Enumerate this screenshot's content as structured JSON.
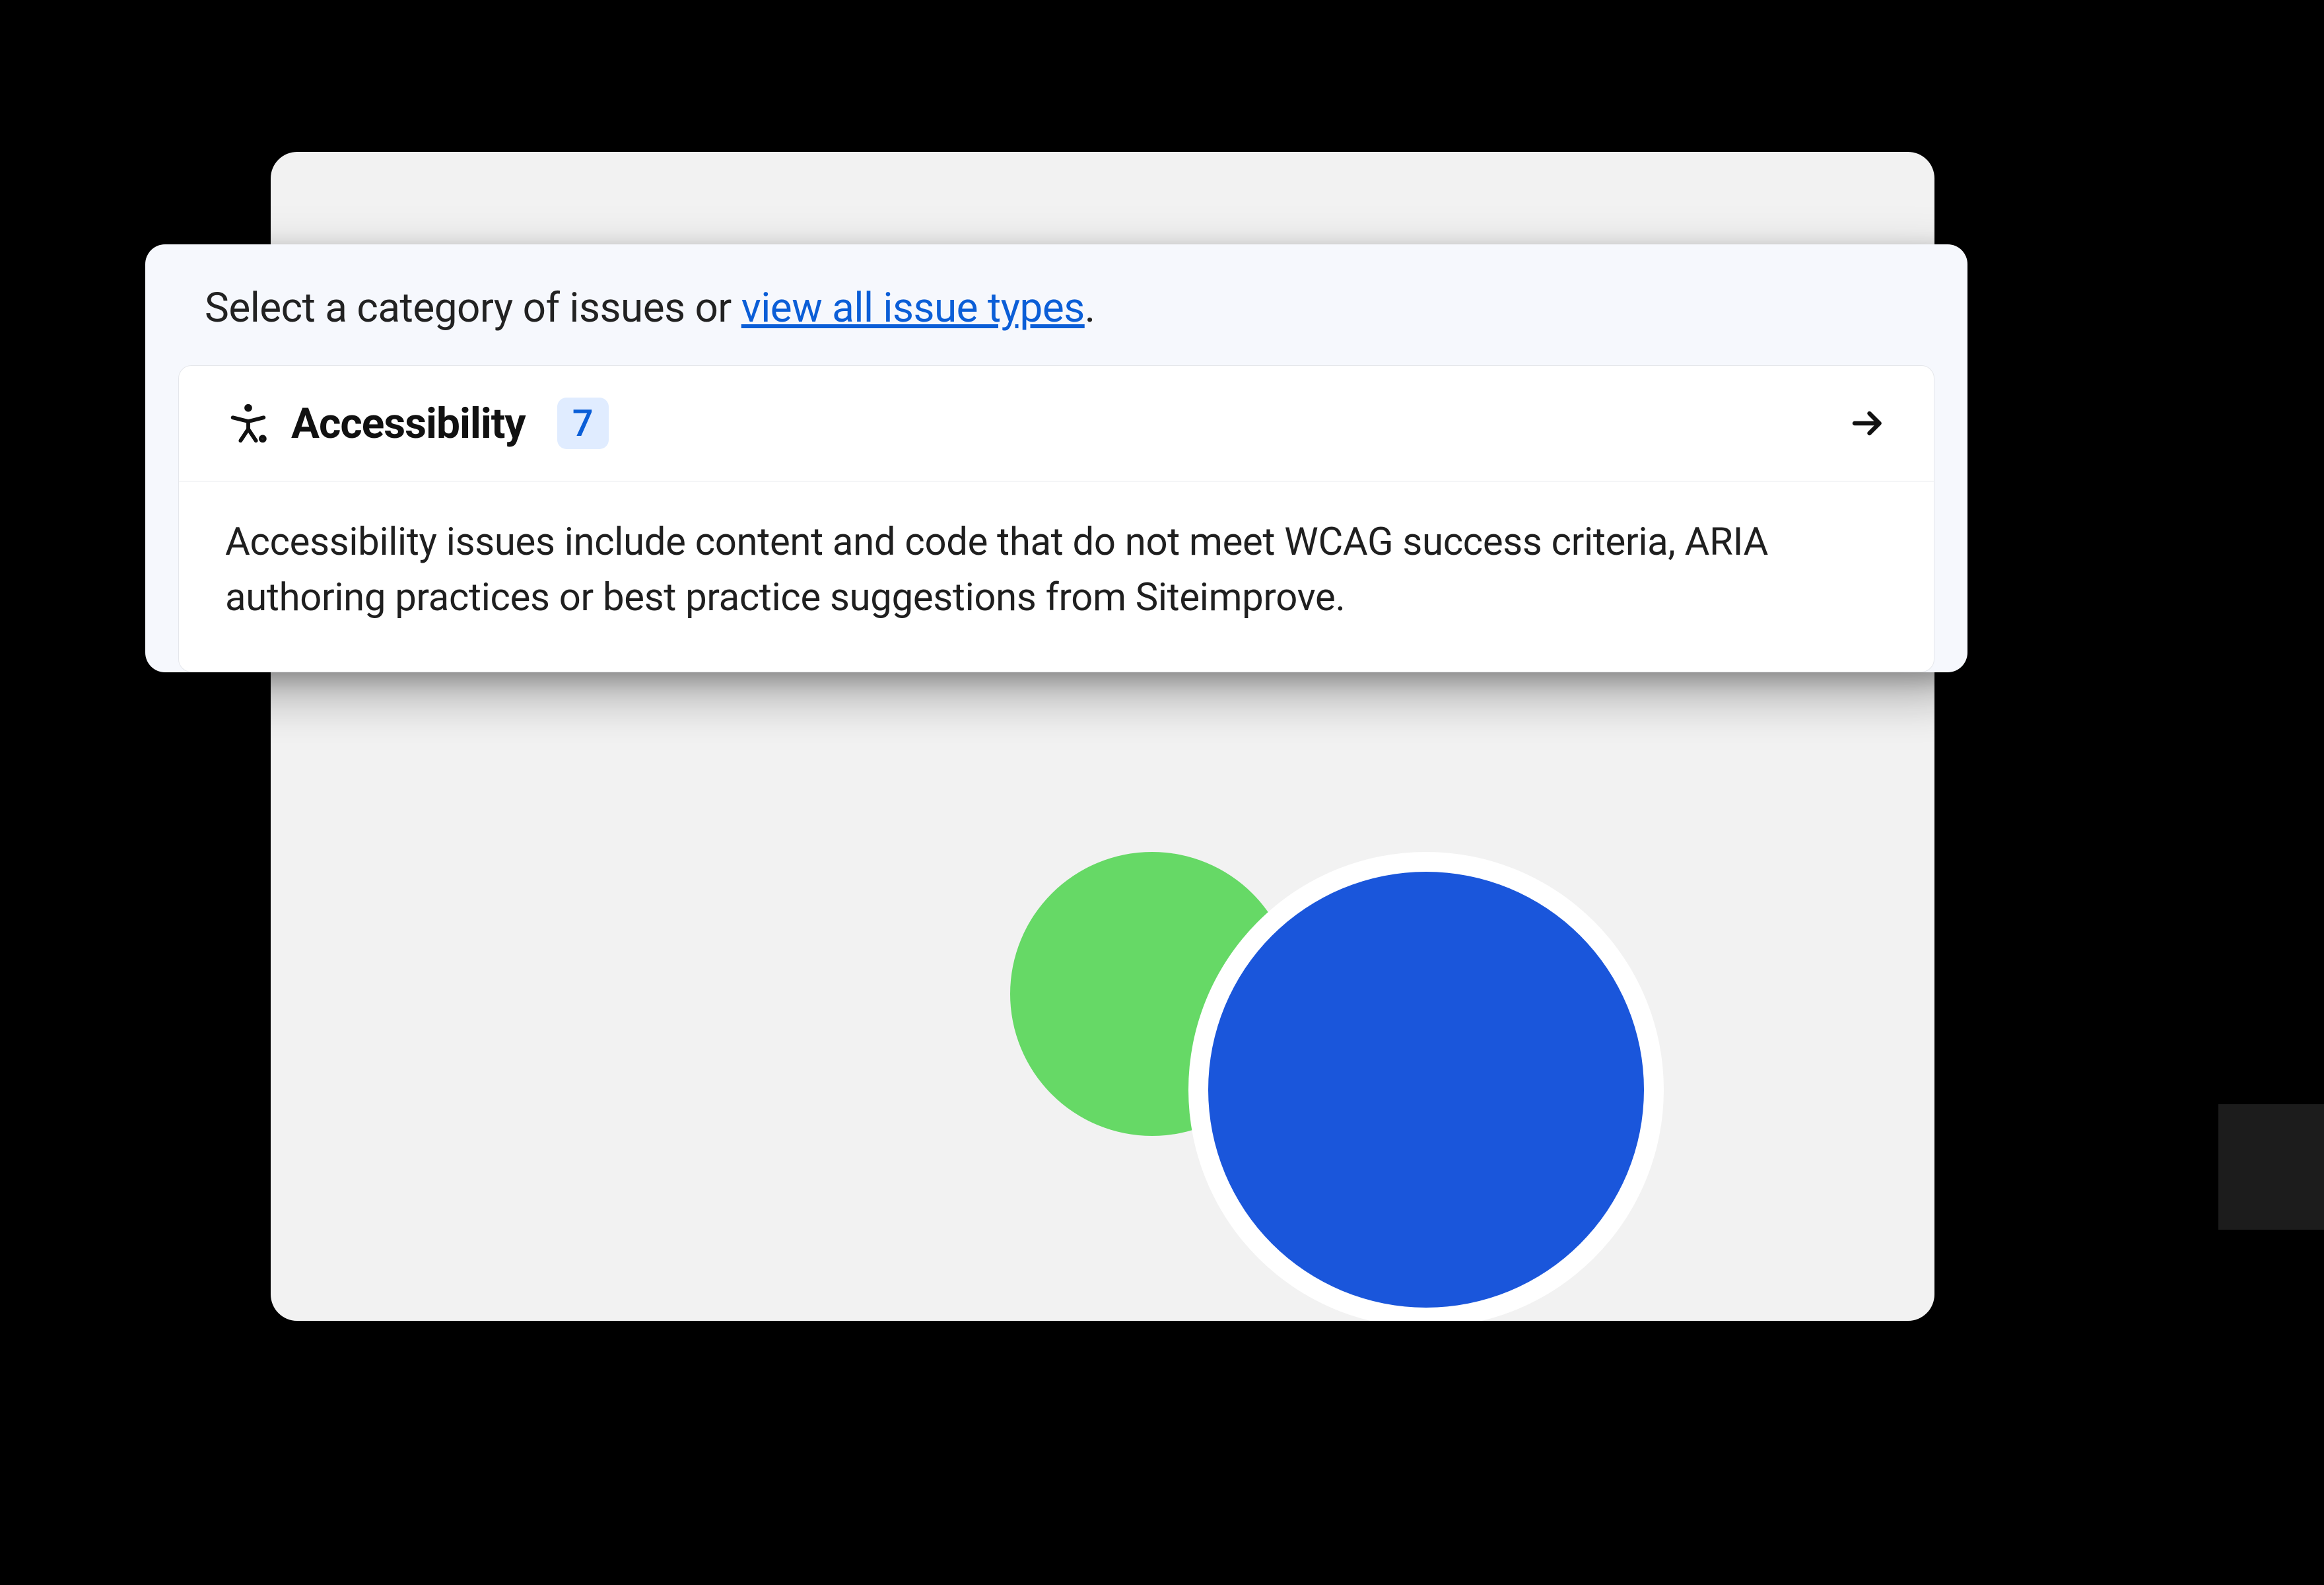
{
  "panel": {
    "instruction_prefix": "Select a category of issues or ",
    "instruction_link": "view all issue types",
    "instruction_suffix": "."
  },
  "category": {
    "title": "Accessibility",
    "count": "7",
    "description": "Accessibility issues include content and code that do not meet WCAG success criteria, ARIA authoring practices or best practice suggestions from Siteimprove."
  },
  "icons": {
    "accessibility": "accessibility-icon",
    "arrow_right": "arrow-right-icon"
  },
  "colors": {
    "link": "#0b5ed7",
    "badge_bg": "#e0ecff",
    "circle_green": "#66d966",
    "circle_blue": "#1a56db"
  }
}
